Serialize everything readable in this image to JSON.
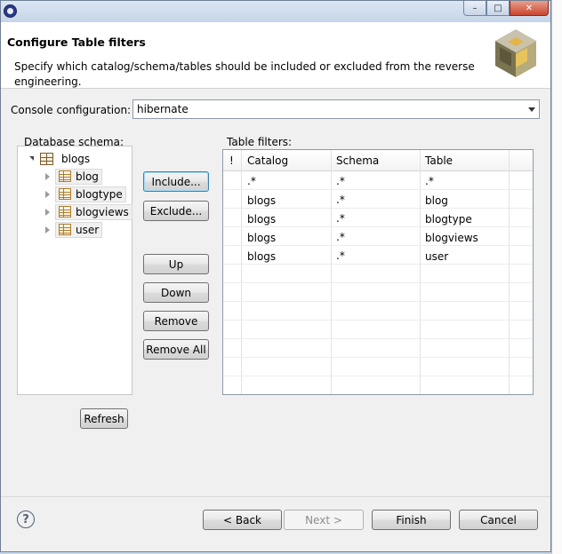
{
  "window": {
    "title": "",
    "caption": {
      "minimize": "–",
      "maximize": "□",
      "close": "✕"
    }
  },
  "header": {
    "title": "Configure Table filters",
    "description": "Specify which catalog/schema/tables should be included or excluded from the reverse engineering."
  },
  "console": {
    "label": "Console configuration:",
    "value": "hibernate"
  },
  "schema": {
    "label": "Database schema:",
    "root": "blogs",
    "tables": [
      "blog",
      "blogtype",
      "blogviews",
      "user"
    ]
  },
  "actions": {
    "include": "Include...",
    "exclude": "Exclude...",
    "up": "Up",
    "down": "Down",
    "remove": "Remove",
    "remove_all": "Remove All",
    "refresh": "Refresh"
  },
  "filters": {
    "label": "Table filters:",
    "columns": [
      "!",
      "Catalog",
      "Schema",
      "Table"
    ],
    "rows": [
      {
        "catalog": ".*",
        "schema": ".*",
        "table": ".*"
      },
      {
        "catalog": "blogs",
        "schema": ".*",
        "table": "blog"
      },
      {
        "catalog": "blogs",
        "schema": ".*",
        "table": "blogtype"
      },
      {
        "catalog": "blogs",
        "schema": ".*",
        "table": "blogviews"
      },
      {
        "catalog": "blogs",
        "schema": ".*",
        "table": "user"
      }
    ]
  },
  "footer": {
    "help": "?",
    "back": "< Back",
    "next": "Next >",
    "finish": "Finish",
    "cancel": "Cancel"
  },
  "icons": {
    "app": "eclipse-icon",
    "help": "help-icon",
    "banner": "hibernate-logo-icon"
  }
}
